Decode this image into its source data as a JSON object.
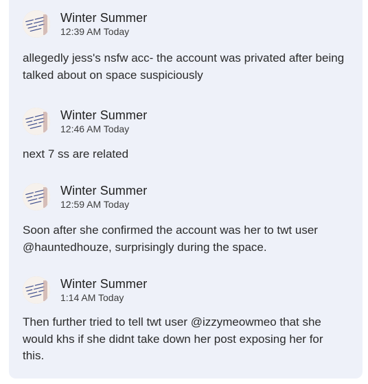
{
  "messages": [
    {
      "author": "Winter Summer",
      "time": "12:39 AM Today",
      "text": "allegedly jess's nsfw acc- the account was privated after being talked about on space suspiciously"
    },
    {
      "author": "Winter Summer",
      "time": "12:46 AM Today",
      "text": "next 7 ss are related"
    },
    {
      "author": "Winter Summer",
      "time": "12:59 AM Today",
      "text": "Soon after she confirmed the account was her to twt user @hauntedhouze, surprisingly during the space."
    },
    {
      "author": "Winter Summer",
      "time": "1:14 AM Today",
      "text": "Then further tried to tell twt user @izzymeowmeo that she would khs if she didnt take down her post exposing her for this."
    }
  ],
  "avatar_icon": "profile-picture-icon"
}
